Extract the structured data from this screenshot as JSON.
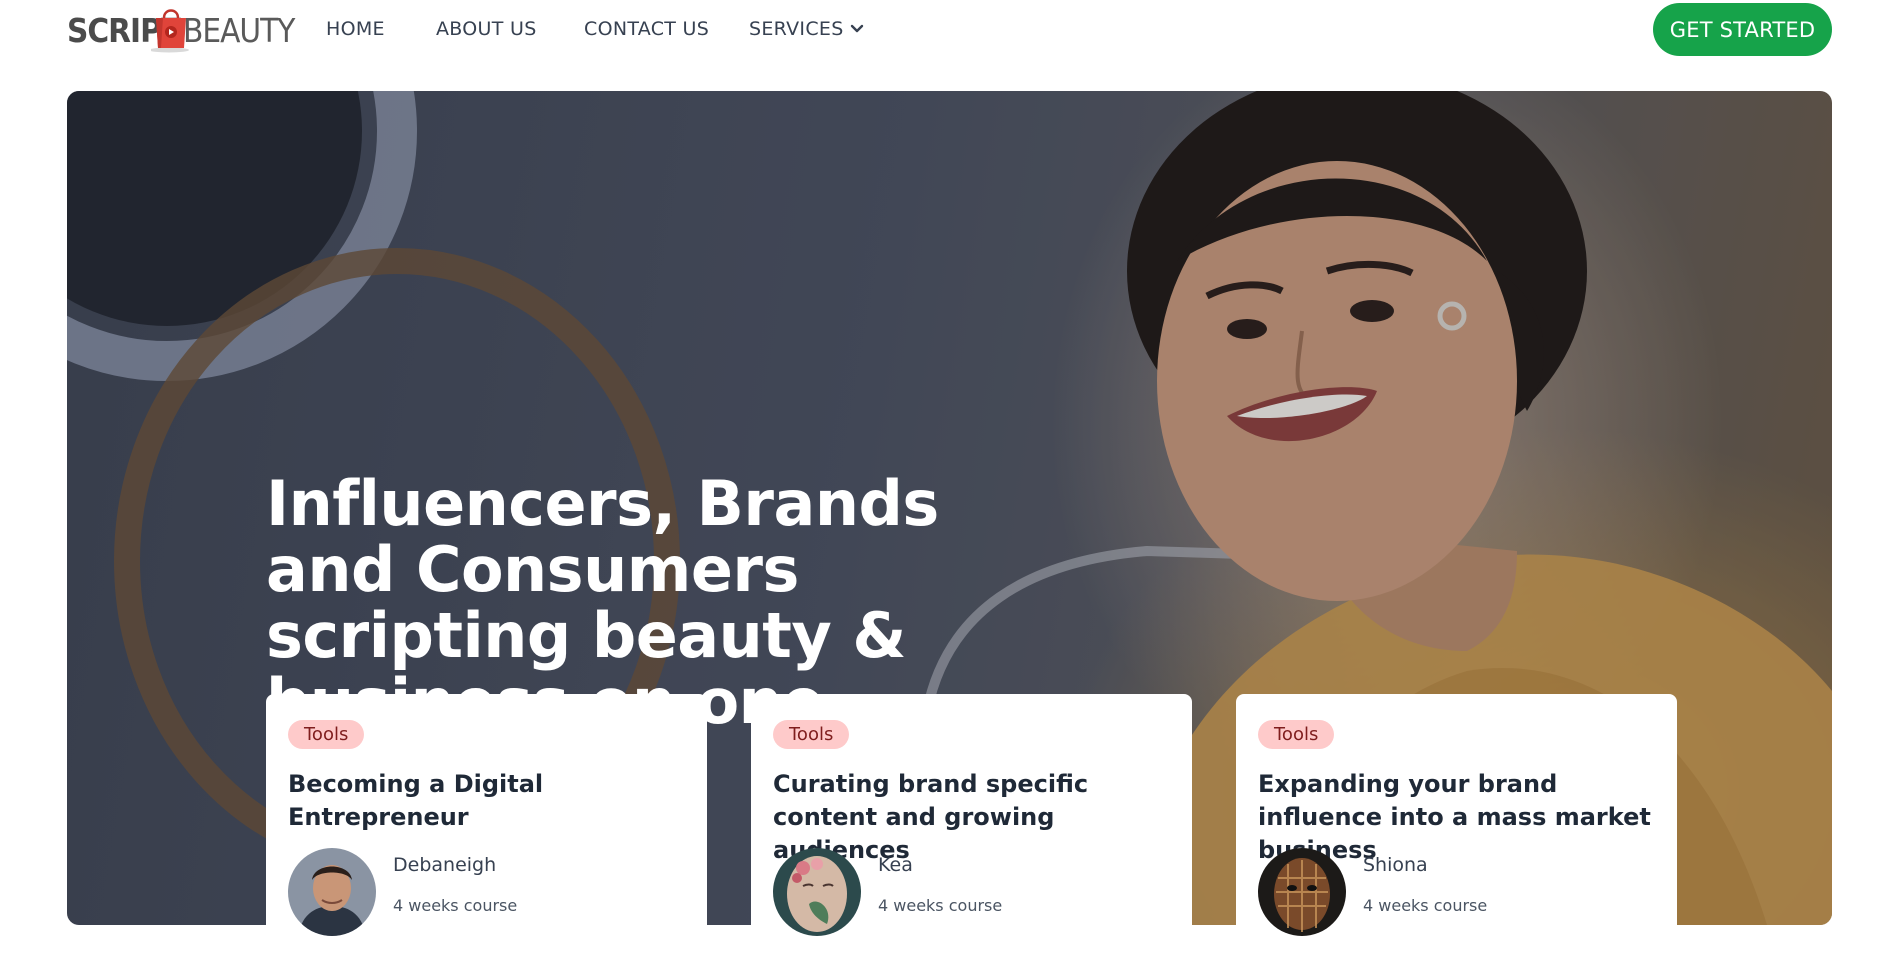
{
  "brand": {
    "logo_left": "SCRIPT",
    "logo_right": "BEAUTY"
  },
  "nav": {
    "items": [
      "HOME",
      "ABOUT US",
      "CONTACT US",
      "SERVICES"
    ],
    "cta": "GET STARTED"
  },
  "hero": {
    "headline": "Influencers, Brands and Consumers scripting beauty & business on one platform"
  },
  "courses": [
    {
      "tag": "Tools",
      "title": "Becoming a Digital Entrepreneur",
      "author": "Debaneigh",
      "duration": "4 weeks course"
    },
    {
      "tag": "Tools",
      "title": "Curating brand specific content and growing audiences",
      "author": "Kea",
      "duration": "4 weeks course"
    },
    {
      "tag": "Tools",
      "title": "Expanding your brand influence into a mass market business",
      "author": "Shiona",
      "duration": "4 weeks course"
    }
  ],
  "colors": {
    "accent": "#16a34a",
    "tag_bg": "#fecaca",
    "tag_text": "#7f1d1d",
    "logo_bag": "#e0443a"
  },
  "icons": {
    "services_dropdown": "chevron-down-icon",
    "logo_mark": "shopping-bag-icon"
  }
}
